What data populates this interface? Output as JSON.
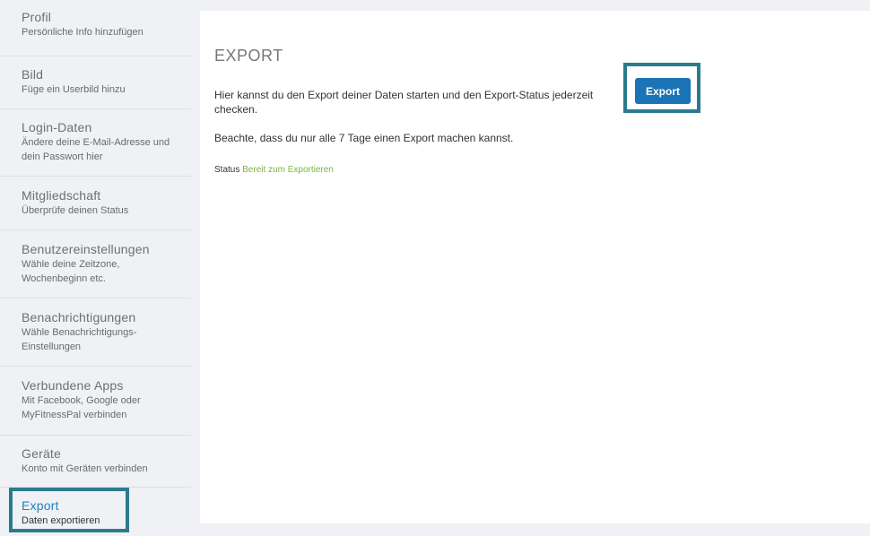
{
  "sidebar": {
    "items": [
      {
        "title": "Profil",
        "subtitle": "Persönliche Info hinzufügen"
      },
      {
        "title": "Bild",
        "subtitle": "Füge ein Userbild hinzu"
      },
      {
        "title": "Login-Daten",
        "subtitle": "Ändere deine E-Mail-Adresse und dein Passwort hier"
      },
      {
        "title": "Mitgliedschaft",
        "subtitle": "Überprüfe deinen Status"
      },
      {
        "title": "Benutzereinstellungen",
        "subtitle": "Wähle deine Zeitzone, Wochenbeginn etc."
      },
      {
        "title": "Benachrichtigungen",
        "subtitle": "Wähle Benachrichtigungs-Einstellungen"
      },
      {
        "title": "Verbundene Apps",
        "subtitle": "Mit Facebook, Google oder MyFitnessPal verbinden"
      },
      {
        "title": "Geräte",
        "subtitle": "Konto mit Geräten verbinden"
      },
      {
        "title": "Export",
        "subtitle": "Daten exportieren"
      }
    ]
  },
  "main": {
    "title": "EXPORT",
    "description": "Hier kannst du den Export deiner Daten starten und den Export-Status jederzeit checken.",
    "note": "Beachte, dass du nur alle 7 Tage einen Export machen kannst.",
    "status_label": "Status",
    "status_value": "Bereit zum Exportieren",
    "export_button": "Export"
  },
  "colors": {
    "accent": "#1b74b5",
    "highlight_frame": "#2b7b8e",
    "status_ok": "#77b73d",
    "background": "#eff1f4"
  }
}
